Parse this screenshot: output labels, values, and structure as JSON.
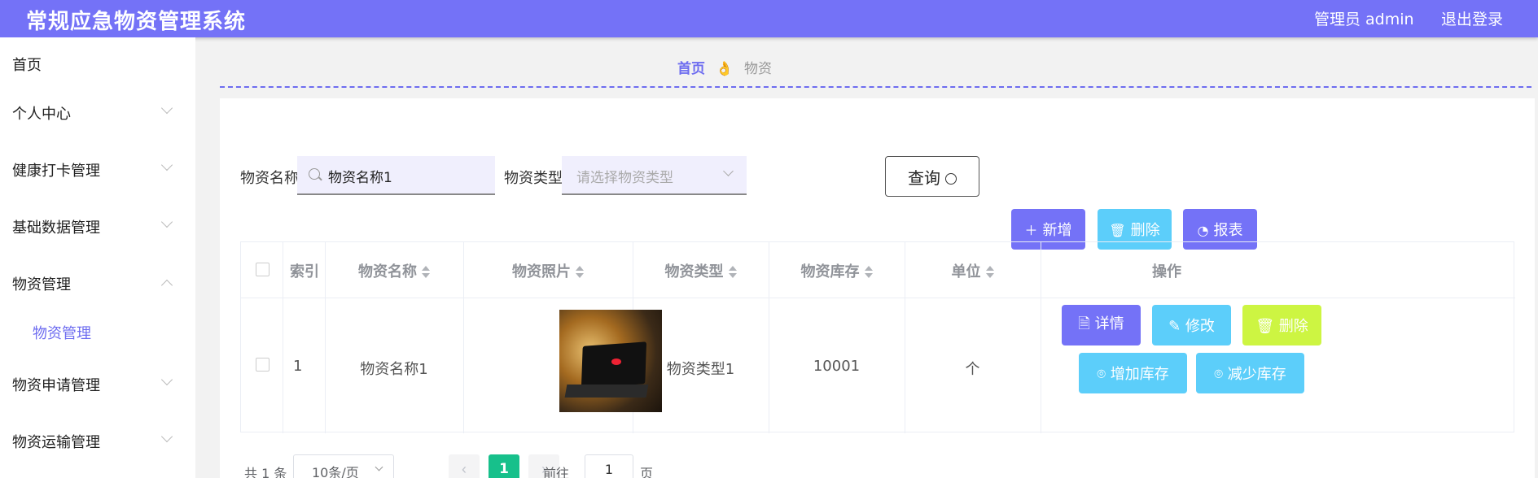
{
  "header": {
    "title": "常规应急物资管理系统",
    "user": "管理员 admin",
    "logout": "退出登录"
  },
  "sidebar": {
    "items": [
      {
        "label": "首页"
      },
      {
        "label": "个人中心"
      },
      {
        "label": "健康打卡管理"
      },
      {
        "label": "基础数据管理"
      },
      {
        "label": "物资管理"
      },
      {
        "label": "物资管理"
      },
      {
        "label": "物资申请管理"
      },
      {
        "label": "物资运输管理"
      }
    ]
  },
  "breadcrumb": {
    "home": "首页",
    "separator": "👌",
    "current": "物资"
  },
  "search": {
    "name_label": "物资名称",
    "name_value": "物资名称1",
    "type_label": "物资类型",
    "type_placeholder": "请选择物资类型",
    "query": "查询"
  },
  "toolbar": {
    "add": "新增",
    "delete": "删除",
    "report": "报表"
  },
  "table": {
    "columns": [
      "索引",
      "物资名称",
      "物资照片",
      "物资类型",
      "物资库存",
      "单位",
      "操作"
    ],
    "rows": [
      {
        "index": "1",
        "name": "物资名称1",
        "type": "物资类型1",
        "stock": "10001",
        "unit": "个"
      }
    ],
    "actions": {
      "detail": "详情",
      "edit": "修改",
      "delete": "删除",
      "add_stock": "增加库存",
      "reduce_stock": "减少库存"
    }
  },
  "pagination": {
    "total": "共 1 条",
    "page_size": "10条/页",
    "current_page": "1",
    "goto": "前往",
    "jump_value": "1",
    "page_suffix": "页"
  },
  "colors": {
    "primary": "#7472f7",
    "cyan": "#5ccefa",
    "lime": "#cdf542",
    "page_active": "#17c08b"
  }
}
